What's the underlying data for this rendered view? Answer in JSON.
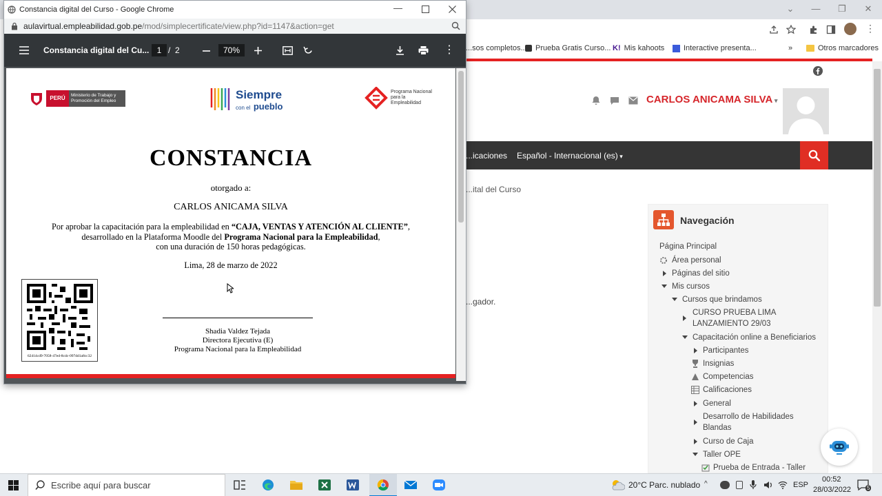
{
  "popup": {
    "window_title": "Constancia digital del Curso - Google Chrome",
    "url_domain": "aulavirtual.empleabilidad.gob.pe",
    "url_path": "/mod/simplecertificate/view.php?id=1147&action=get",
    "pdf_toolbar": {
      "doc_title": "Constancia digital del Cu...",
      "page_current": "1",
      "page_sep": "/",
      "page_total": "2",
      "zoom": "70%"
    }
  },
  "certificate": {
    "logo1_country": "PERÚ",
    "logo1_text": "Ministerio de Trabajo y Promoción del Empleo",
    "logo2_text_a": "Siempre",
    "logo2_text_b": "con el",
    "logo2_text_c": "pueblo",
    "logo3_text": "Programa Nacional para la Empleabilidad",
    "heading": "CONSTANCIA",
    "granted": "otorgado a:",
    "recipient": "CARLOS ANICAMA SILVA",
    "line1_pre": "Por aprobar la capacitación para la empleabilidad en ",
    "line1_course": "“CAJA, VENTAS Y ATENCIÓN AL CLIENTE”",
    "line1_post": ",",
    "line2_pre": "desarrollado en la Plataforma Moodle del ",
    "line2_program": "Programa Nacional para la Empleabilidad",
    "line2_post": ",",
    "line3": "con una duración de 150 horas pedagógicas.",
    "place_date": "Lima, 28 de marzo de 2022",
    "qr_code": "62414cd9-7058-47ed-8cdc-097dd1a8cc32",
    "signer_name": "Shadia Valdez Tejada",
    "signer_role": "Directora Ejecutiva (E)",
    "signer_org": "Programa Nacional para la Empleabilidad"
  },
  "background": {
    "bookmarks": [
      "...sos completos...",
      "Prueba Gratis Curso...",
      "Mis kahoots",
      "Interactive presenta...",
      "»",
      "Otros marcadores"
    ],
    "user_name": "CARLOS ANICAMA SILVA",
    "nav_items": [
      "...icaciones",
      "Español - Internacional (es)"
    ],
    "breadcrumb": "...ital del Curso",
    "body_text": "...gador.",
    "navigation": {
      "title": "Navegación",
      "items": [
        "Página Principal",
        "Área personal",
        "Páginas del sitio",
        "Mis cursos",
        "Cursos que brindamos",
        "CURSO PRUEBA LIMA LANZAMIENTO 29/03",
        "Capacitación online a Beneficiarios",
        "Participantes",
        "Insignias",
        "Competencias",
        "Calificaciones",
        "General",
        "Desarrollo de Habilidades Blandas",
        "Curso de Caja",
        "Taller OPE",
        "Prueba de Entrada - Taller"
      ]
    }
  },
  "taskbar": {
    "search_placeholder": "Escribe aquí para buscar",
    "weather": "20°C  Parc. nublado",
    "lang": "ESP",
    "time": "00:52",
    "date": "28/03/2022",
    "notif_count": "5"
  },
  "colors": {
    "brand_red": "#e02e24",
    "pdf_toolbar": "#323639",
    "site_nav": "#353535"
  }
}
